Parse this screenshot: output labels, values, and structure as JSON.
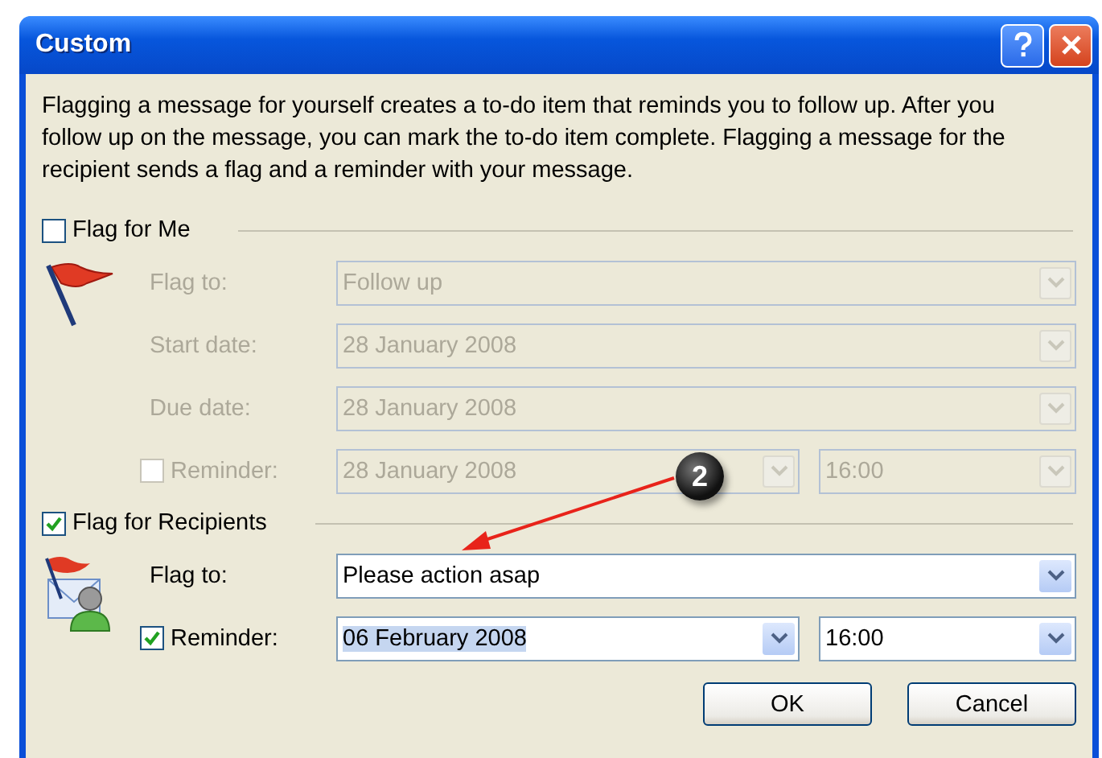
{
  "window": {
    "title": "Custom"
  },
  "description": "Flagging a message for yourself creates a to-do item that reminds you to follow up. After you follow up on the message, you can mark the to-do item complete. Flagging a message for the recipient sends a flag and a reminder with your message.",
  "sections": [
    {
      "label": "Flag for Me",
      "checked": false,
      "rows": [
        {
          "kind": "combo",
          "label": "Flag to:",
          "value": "Follow up"
        },
        {
          "kind": "combo",
          "label": "Start date:",
          "value": "28 January 2008"
        },
        {
          "kind": "combo",
          "label": "Due date:",
          "value": "28 January 2008"
        },
        {
          "kind": "reminder",
          "label": "Reminder:",
          "checked": false,
          "date": "28 January 2008",
          "time": "16:00",
          "date_highlighted": false
        }
      ]
    },
    {
      "label": "Flag for Recipients",
      "checked": true,
      "rows": [
        {
          "kind": "combo",
          "label": "Flag to:",
          "value": "Please action asap"
        },
        {
          "kind": "reminder",
          "label": "Reminder:",
          "checked": true,
          "date": "06 February 2008",
          "time": "16:00",
          "date_highlighted": true
        }
      ]
    }
  ],
  "callout": {
    "number": "2"
  },
  "buttons": [
    "OK",
    "Cancel"
  ]
}
